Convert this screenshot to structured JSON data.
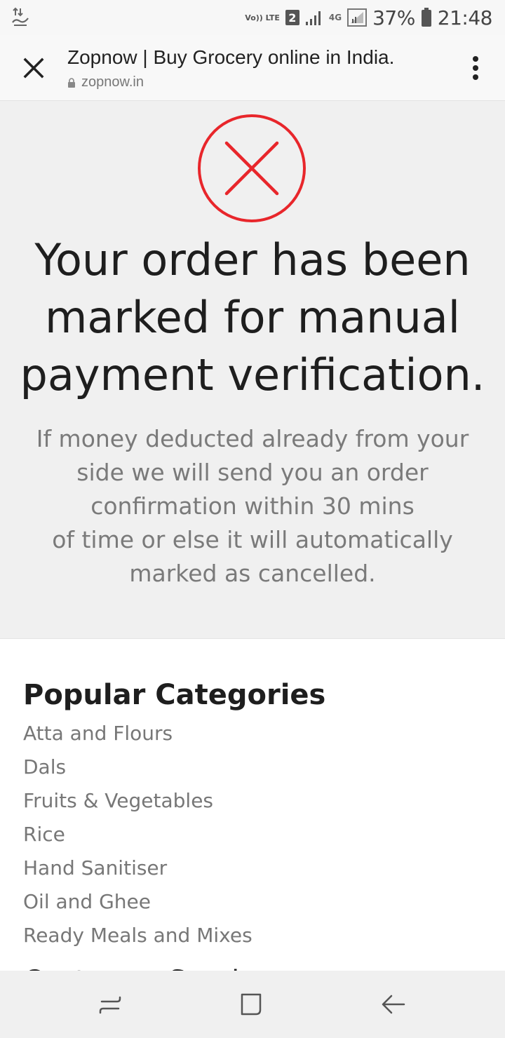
{
  "status_bar": {
    "volte_label": "Vo)) LTE",
    "sim_slot": "2",
    "network_type": "4G",
    "battery_percent": "37%",
    "time": "21:48",
    "icons": [
      "data-transfer-icon",
      "signal-strength-icon",
      "battery-icon"
    ]
  },
  "header": {
    "title": "Zopnow | Buy Grocery online in India.",
    "url": "zopnow.in",
    "icons": [
      "close-icon",
      "lock-icon",
      "more-vert-icon"
    ]
  },
  "result": {
    "icon": "error-circle-x-icon",
    "headline_lines": [
      "Your order has been",
      "marked for manual",
      "payment verification."
    ],
    "message_lines": [
      "If money deducted already from your",
      "side we will send you an order",
      "confirmation within 30 mins",
      "of time or else it will automatically",
      "marked as cancelled."
    ],
    "accent_color": "#e8262b"
  },
  "footer": {
    "heading": "Popular Categories",
    "items": [
      "Atta and Flours",
      "Dals",
      "Fruits & Vegetables",
      "Rice",
      "Hand Sanitiser",
      "Oil and Ghee",
      "Ready Meals and Mixes"
    ],
    "next_heading_partial": "Customer Service"
  },
  "nav_bar": {
    "icons": [
      "recent-apps-icon",
      "home-icon",
      "back-icon"
    ]
  }
}
